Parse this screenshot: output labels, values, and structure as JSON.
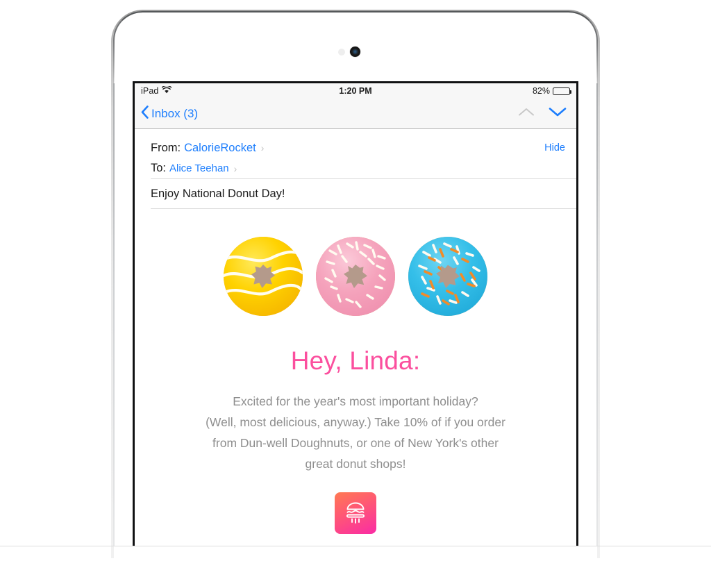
{
  "device": {
    "name": "ipad",
    "camera_icon": "camera-lens",
    "sensor_icon": "ambient-light-sensor"
  },
  "status_bar": {
    "carrier": "iPad",
    "wifi_icon": "wifi-icon",
    "time": "1:20 PM",
    "battery_percent": "82%",
    "battery_level": 82,
    "battery_icon": "battery-icon"
  },
  "nav_bar": {
    "back_label": "Inbox (3)",
    "back_icon": "chevron-left-icon",
    "prev_message_icon": "chevron-up-icon",
    "next_message_icon": "chevron-down-icon",
    "prev_enabled": false,
    "next_enabled": true
  },
  "mail_header": {
    "from_label": "From:",
    "from_value": "CalorieRocket",
    "to_label": "To:",
    "to_value": "Alice Teehan",
    "disclosure_icon": "chevron-right-icon",
    "hide_label": "Hide",
    "subject": "Enjoy National Donut Day!"
  },
  "mail_body": {
    "donuts": [
      {
        "name": "yellow-donut",
        "glaze": "#FFD500",
        "drizzle": "#FFFFFF"
      },
      {
        "name": "pink-donut",
        "glaze": "#F5A7BE",
        "drizzle": "#FFFFFF"
      },
      {
        "name": "blue-donut",
        "glaze": "#32BEE8",
        "drizzle": "#FFFFFF",
        "sprinkles": "#F28B28"
      }
    ],
    "greeting": "Hey, Linda:",
    "paragraph_lines": [
      "Excited for the year's most important holiday?",
      "(Well, most delicious, anyway.) Take 10% of if you order",
      "from Dun-well Doughnuts, or one of New York's other",
      "great donut shops!"
    ],
    "logo_icon": "burger-rocket-logo-icon"
  },
  "colors": {
    "ios_blue": "#1D7EFD",
    "greeting_pink": "#FB4F9E",
    "body_gray": "#8E8E8E",
    "status_bg": "#F7F7F7",
    "logo_gradient_start": "#FF7A52",
    "logo_gradient_end": "#FA2BA5"
  }
}
